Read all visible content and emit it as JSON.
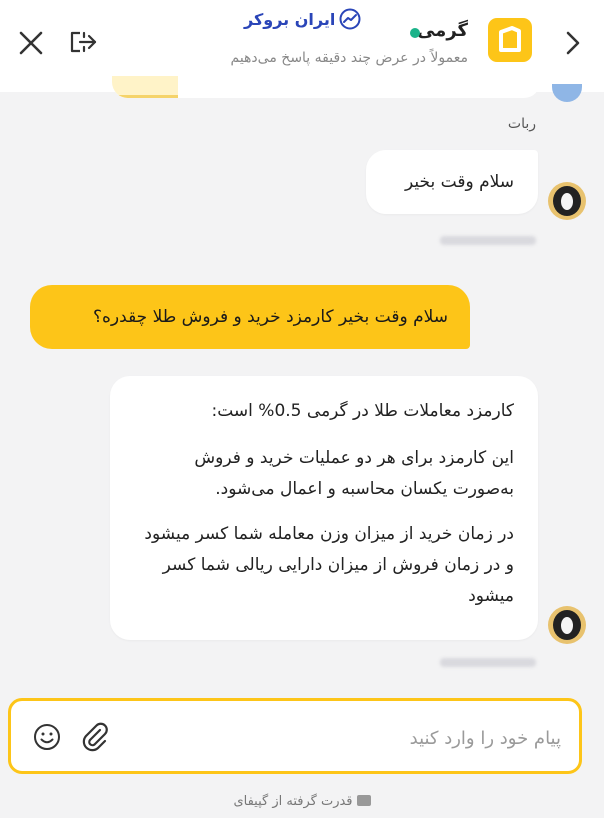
{
  "header": {
    "contact_name": "گرمی",
    "status_subtitle": "معمولاً در عرض چند دقیقه پاسخ می‌دهیم",
    "watermark_text": "ایران بروکر",
    "online_color": "#1bb38a",
    "brand_color": "#fdc518"
  },
  "messages": [
    {
      "sender": "bot",
      "label": "ربات"
    },
    {
      "sender": "agent",
      "text": "سلام وقت بخیر"
    },
    {
      "sender": "user",
      "text": "سلام وقت بخیر کارمزد خرید و فروش طلا چقدره؟"
    },
    {
      "sender": "agent",
      "paragraphs": [
        "کارمزد معاملات طلا در گرمی 0.5% است:",
        "این کارمزد برای هر دو عملیات خرید و فروش به‌صورت یکسان محاسبه و اعمال می‌شود.",
        "در زمان خرید از میزان وزن معامله شما کسر میشود و در زمان فروش از میزان دارایی ریالی شما کسر میشود"
      ]
    }
  ],
  "composer": {
    "placeholder": "پیام خود را وارد کنید"
  },
  "footer": {
    "powered_by": "قدرت گرفته از گپیفای"
  },
  "icons": {
    "back": "chevron-right-icon",
    "logo": "goldino-logo",
    "exit": "exit-icon",
    "close": "close-icon",
    "emoji": "smiley-icon",
    "attach": "paperclip-icon"
  }
}
